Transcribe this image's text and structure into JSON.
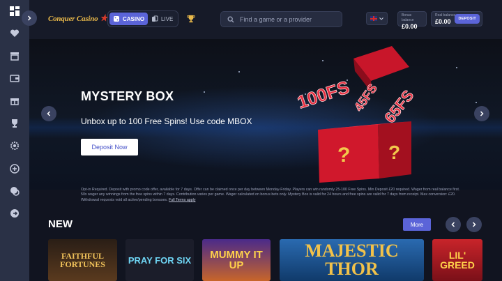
{
  "sidebar": {
    "items": [
      {
        "icon": "grid-icon"
      },
      {
        "icon": "heart-icon"
      },
      {
        "icon": "store-icon"
      },
      {
        "icon": "wallet-icon"
      },
      {
        "icon": "gift-icon"
      },
      {
        "icon": "trophy-icon"
      },
      {
        "icon": "gear-icon"
      },
      {
        "icon": "plus-circle-icon"
      },
      {
        "icon": "chat-icon"
      },
      {
        "icon": "logout-icon"
      }
    ]
  },
  "header": {
    "logo_text": "Conquer Casino",
    "mode": {
      "casino_label": "CASINO",
      "live_label": "LIVE",
      "active": "casino"
    },
    "search": {
      "placeholder": "Find a game or a provider"
    },
    "language": "EN",
    "bonus_balance": {
      "label": "Bonus balance",
      "value": "£0.00"
    },
    "real_balance": {
      "label": "Real balance",
      "value": "£0.00"
    },
    "deposit_label": "DEPOSIT"
  },
  "banner": {
    "title": "MYSTERY BOX",
    "subtitle": "Unbox up to 100 Free Spins! Use code MBOX",
    "cta_label": "Deposit Now",
    "art_labels": [
      "100FS",
      "45FS",
      "65FS"
    ],
    "terms_text": "Opt-in Required. Deposit with promo code offer, available for 7 days. Offer can be claimed once per day between Monday-Friday. Players can win randomly 25-100 Free Spins. Min Deposit £20 required. Wager from real balance first. 50x wager any winnings from the free spins within 7 days. Contribution varies per game. Wager calculated on bonus bets only. Mystery Box is valid for 24 hours and free spins are valid for 7 days from receipt. Max conversion: £20. Withdrawal requests void all active/pending bonuses.",
    "terms_link": "Full Terms apply"
  },
  "new_section": {
    "title": "NEW",
    "more_label": "More",
    "games": [
      {
        "name": "FAITHFUL FORTUNES",
        "color": "#3a2a1e"
      },
      {
        "name": "PRAY FOR SIX",
        "color": "#1b1d2a"
      },
      {
        "name": "MUMMY IT UP",
        "color": "#4a2a8a"
      },
      {
        "name": "MAJESTIC THOR",
        "color": "#1b5a9a"
      },
      {
        "name": "LIL' GREED",
        "color": "#b0242a"
      }
    ]
  },
  "colors": {
    "accent": "#5b64d8",
    "sidebar": "#2a3146",
    "background": "#111420"
  }
}
